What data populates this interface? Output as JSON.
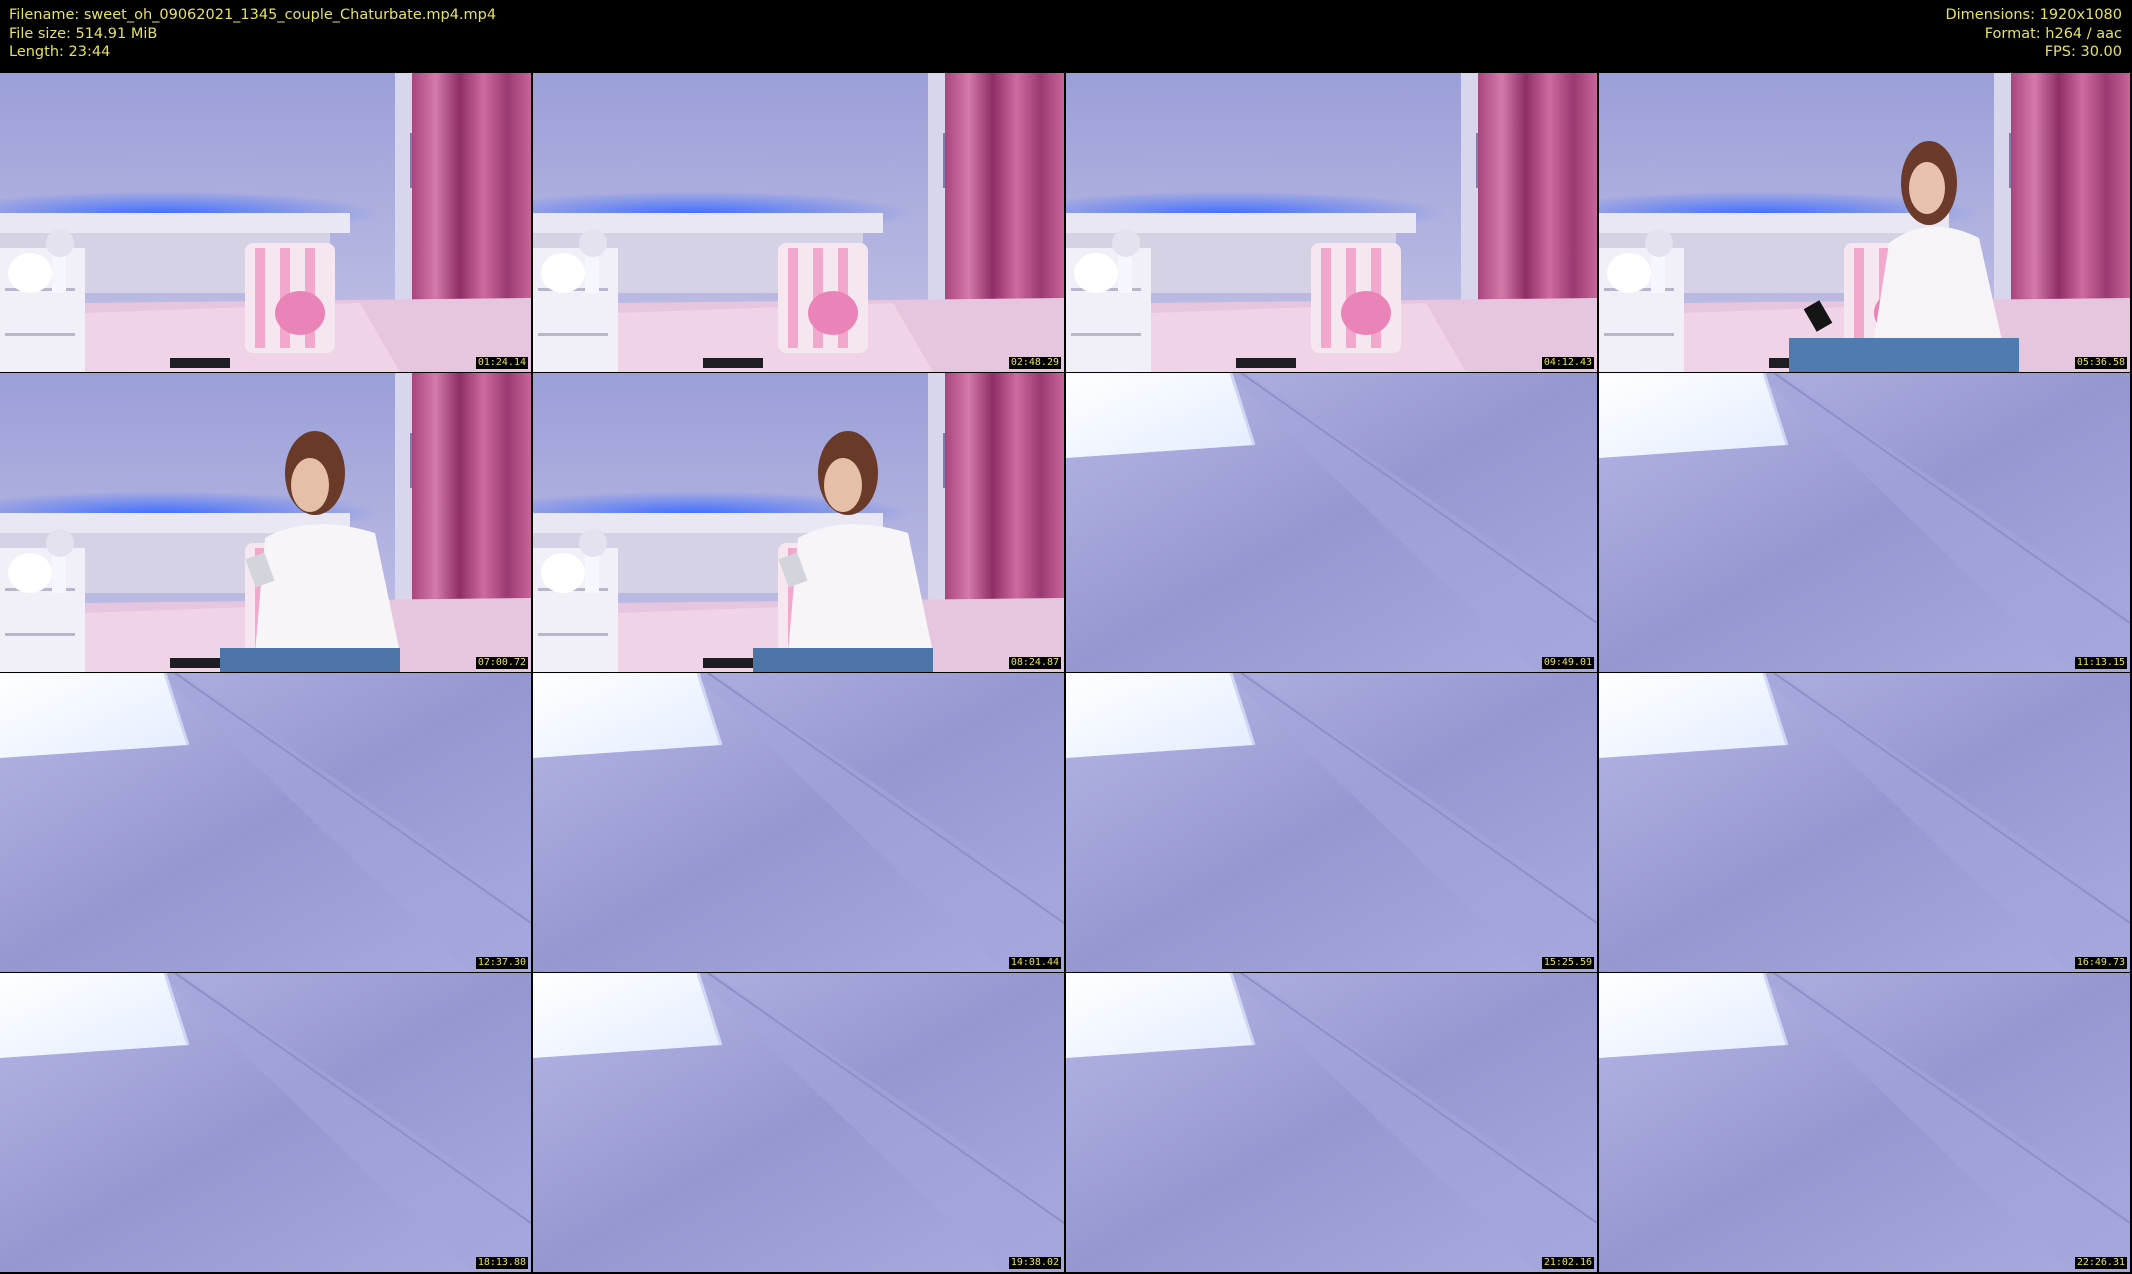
{
  "info": {
    "filename": "Filename: sweet_oh_09062021_1345_couple_Chaturbate.mp4.mp4",
    "filesize": "File size: 514.91 MiB",
    "length": "Length: 23:44",
    "dimensions": "Dimensions: 1920x1080",
    "format": "Format: h264 / aac",
    "fps": "FPS: 30.00"
  },
  "colors": {
    "text": "#e8e25a",
    "background": "#000000"
  },
  "thumbnails": [
    {
      "time": "01:24.14",
      "scene": "bedroom"
    },
    {
      "time": "02:48.29",
      "scene": "bedroom"
    },
    {
      "time": "04:12.43",
      "scene": "bedroom"
    },
    {
      "time": "05:36.58",
      "scene": "bedroom-woman-moving"
    },
    {
      "time": "07:00.72",
      "scene": "bedroom-woman-phone"
    },
    {
      "time": "08:24.87",
      "scene": "bedroom-woman-phone"
    },
    {
      "time": "09:49.01",
      "scene": "ceiling"
    },
    {
      "time": "11:13.15",
      "scene": "ceiling"
    },
    {
      "time": "12:37.30",
      "scene": "ceiling"
    },
    {
      "time": "14:01.44",
      "scene": "ceiling"
    },
    {
      "time": "15:25.59",
      "scene": "ceiling"
    },
    {
      "time": "16:49.73",
      "scene": "ceiling"
    },
    {
      "time": "18:13.88",
      "scene": "ceiling"
    },
    {
      "time": "19:38.02",
      "scene": "ceiling"
    },
    {
      "time": "21:02.16",
      "scene": "ceiling"
    },
    {
      "time": "22:26.31",
      "scene": "ceiling"
    }
  ]
}
